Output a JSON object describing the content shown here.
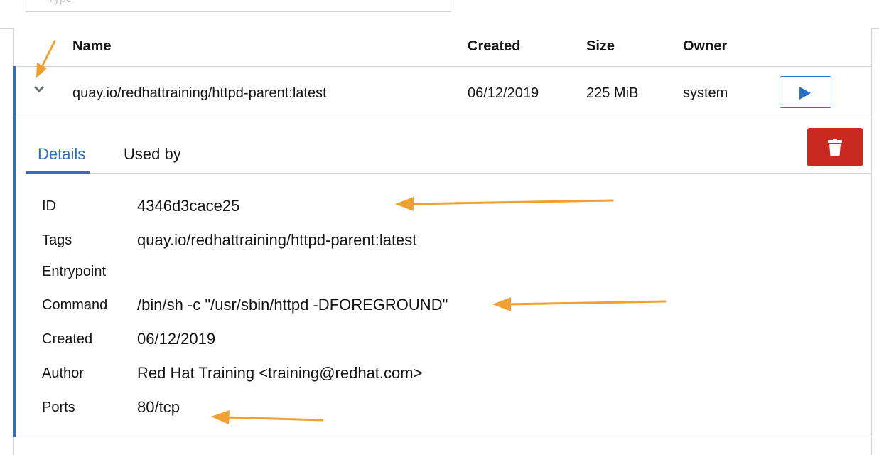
{
  "search": {
    "placeholder": "Type"
  },
  "table": {
    "headers": [
      "Name",
      "Created",
      "Size",
      "Owner"
    ],
    "row": {
      "name": "quay.io/redhattraining/httpd-parent:latest",
      "created": "06/12/2019",
      "size": "225 MiB",
      "owner": "system"
    }
  },
  "tabs": [
    "Details",
    "Used by"
  ],
  "details": [
    {
      "label": "ID",
      "value": "4346d3cace25"
    },
    {
      "label": "Tags",
      "value": "quay.io/redhattraining/httpd-parent:latest"
    },
    {
      "label": "Entrypoint",
      "value": ""
    },
    {
      "label": "Command",
      "value": "/bin/sh -c \"/usr/sbin/httpd -DFOREGROUND\""
    },
    {
      "label": "Created",
      "value": "06/12/2019"
    },
    {
      "label": "Author",
      "value": "Red Hat Training <training@redhat.com>"
    },
    {
      "label": "Ports",
      "value": "80/tcp"
    }
  ],
  "icons": {
    "expand": "chevron-down-icon",
    "run": "play-icon",
    "delete": "trash-icon"
  },
  "colors": {
    "accent": "#2b6fc7",
    "danger": "#c9291e",
    "annotation": "#f0a030"
  }
}
